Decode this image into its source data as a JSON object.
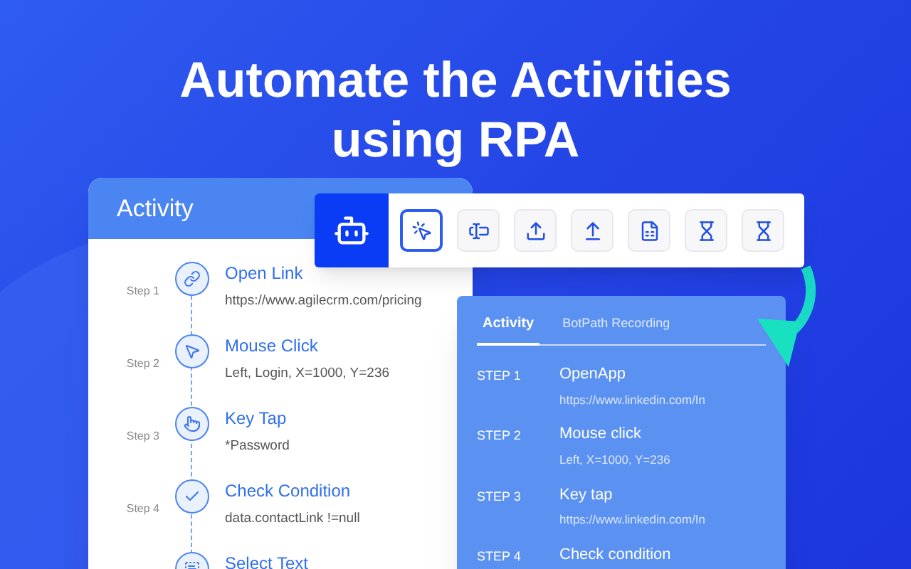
{
  "headline": [
    "Automate the Activities",
    "using RPA"
  ],
  "activity_panel": {
    "title": "Activity",
    "steps": [
      {
        "step": "Step 1",
        "title": "Open Link",
        "detail": "https://www.agilecrm.com/pricing"
      },
      {
        "step": "Step 2",
        "title": "Mouse Click",
        "detail": "Left, Login, X=1000, Y=236"
      },
      {
        "step": "Step 3",
        "title": "Key Tap",
        "detail": "*Password"
      },
      {
        "step": "Step 4",
        "title": "Check Condition",
        "detail": "data.contactLink !=null"
      },
      {
        "title": "Select Text"
      }
    ]
  },
  "toolbar": {
    "tools": [
      {
        "selected": true
      },
      {
        "selected": false
      },
      {
        "selected": false
      },
      {
        "selected": false
      },
      {
        "selected": false
      },
      {
        "selected": false
      },
      {
        "selected": false
      }
    ]
  },
  "recording_panel": {
    "tabs": [
      {
        "label": "Activity",
        "selected": true
      },
      {
        "label": "BotPath Recording",
        "selected": false
      }
    ],
    "steps": [
      {
        "step": "STEP 1",
        "title": "OpenApp",
        "detail": "https://www.linkedin.com/In"
      },
      {
        "step": "STEP 2",
        "title": "Mouse click",
        "detail": "Left, X=1000, Y=236"
      },
      {
        "step": "STEP 3",
        "title": "Key tap",
        "detail": "https://www.linkedin.com/In"
      },
      {
        "step": "STEP 4",
        "title": "Check condition"
      }
    ]
  }
}
